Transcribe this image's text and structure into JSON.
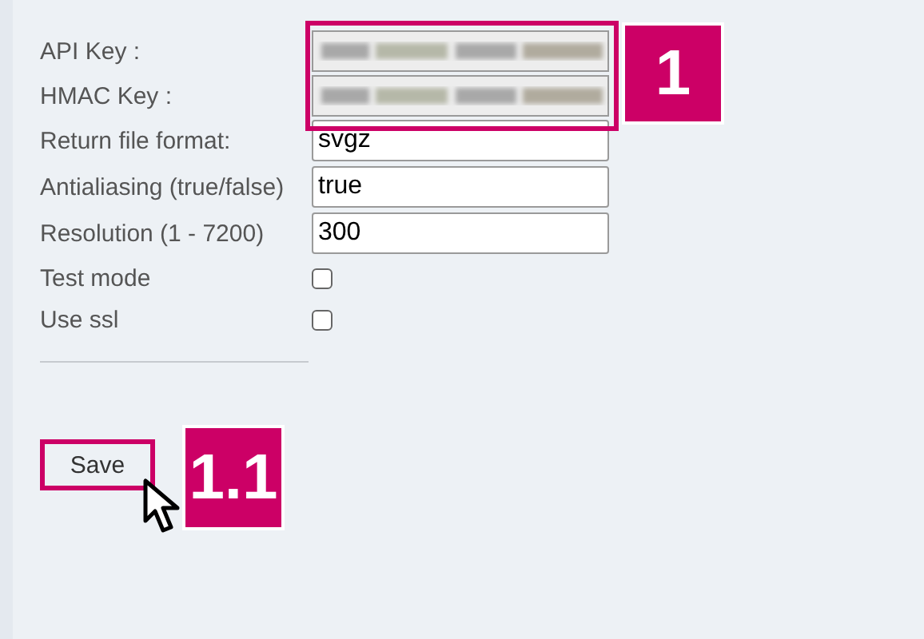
{
  "fields": [
    {
      "label": "API Key :",
      "kind": "redacted"
    },
    {
      "label": "HMAC Key :",
      "kind": "redacted"
    },
    {
      "label": "Return file format:",
      "kind": "text",
      "value": "svgz"
    },
    {
      "label": "Antialiasing (true/false)",
      "kind": "text",
      "value": "true"
    },
    {
      "label": "Resolution (1 - 7200)",
      "kind": "text",
      "value": "300"
    },
    {
      "label": "Test mode",
      "kind": "checkbox",
      "checked": false
    },
    {
      "label": "Use ssl",
      "kind": "checkbox",
      "checked": false
    }
  ],
  "save_button": "Save",
  "callouts": [
    "1",
    "1.1"
  ]
}
